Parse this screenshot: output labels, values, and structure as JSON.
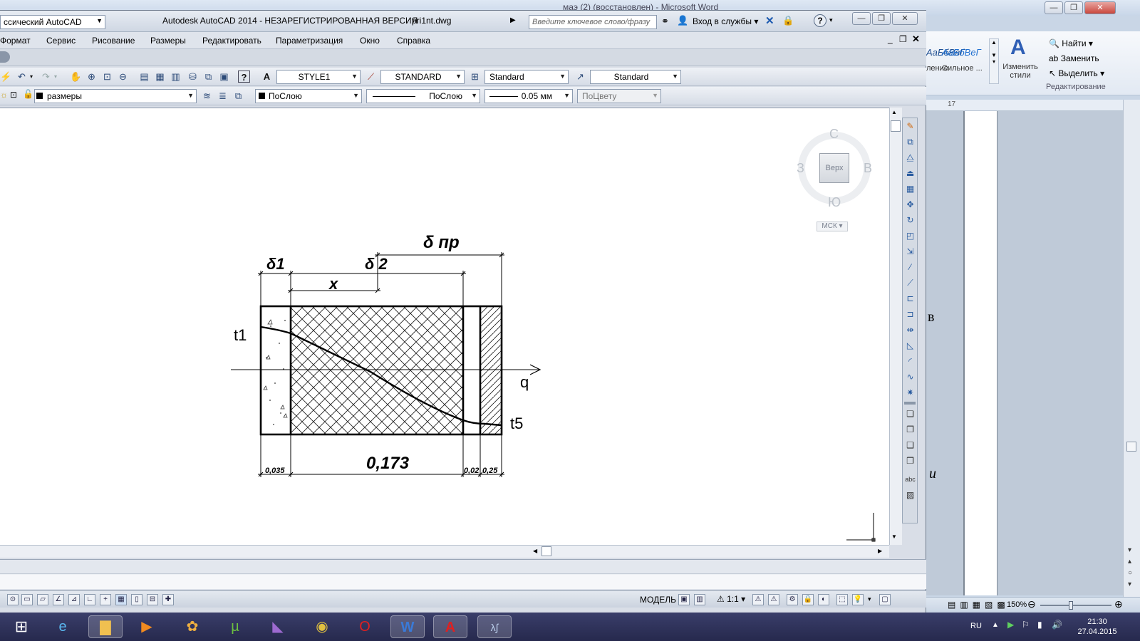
{
  "autocad": {
    "workspace": "ссический AutoCAD",
    "title": "Autodesk AutoCAD 2014 - НЕЗАРЕГИСТРИРОВАННАЯ ВЕРСИЯ",
    "file": "pri1nt.dwg",
    "search_placeholder": "Введите ключевое слово/фразу",
    "login": "Вход в службы",
    "menu": [
      "Формат",
      "Сервис",
      "Рисование",
      "Размеры",
      "Редактировать",
      "Параметризация",
      "Окно",
      "Справка"
    ],
    "text_style": "STYLE1",
    "dim_style": "STANDARD",
    "table_style": "Standard",
    "multileader_style": "Standard",
    "layer": "размеры",
    "color": "ПоСлою",
    "linetype": "ПоСлою",
    "lineweight": "0.05 мм",
    "plot_style": "ПоЦвету",
    "viewcube": {
      "north": "С",
      "south": "Ю",
      "west": "З",
      "east": "В",
      "face": "Верх",
      "ucs": "МСК"
    },
    "status_model": "МОДЕЛЬ",
    "status_scale": "1:1"
  },
  "drawing": {
    "labels": {
      "delta_pr": "δ пр",
      "delta1": "δ1",
      "delta2": "δ 2",
      "x": "x",
      "t1": "t1",
      "t5": "t5",
      "q": "q",
      "dim_0035": "0,035",
      "dim_0173": "0,173",
      "dim_002": "0,02",
      "dim_025": "0,25"
    }
  },
  "word": {
    "title_fragment": "маэ (2) (восстановлен) - Microsoft Word",
    "style1": "АаБбВвГ",
    "style1_caption": "ление",
    "style2": "АаБбВеГ",
    "style2_caption": "Сильное ...",
    "change_styles": "Изменить стили",
    "find": "Найти",
    "replace": "Заменить",
    "select": "Выделить",
    "editing_group": "Редактирование",
    "ruler_mark": "17",
    "page_letter1": "в",
    "page_letter2": "и",
    "zoom": "150%"
  },
  "taskbar": {
    "lang": "RU",
    "time": "21:30",
    "date": "27.04.2015"
  }
}
